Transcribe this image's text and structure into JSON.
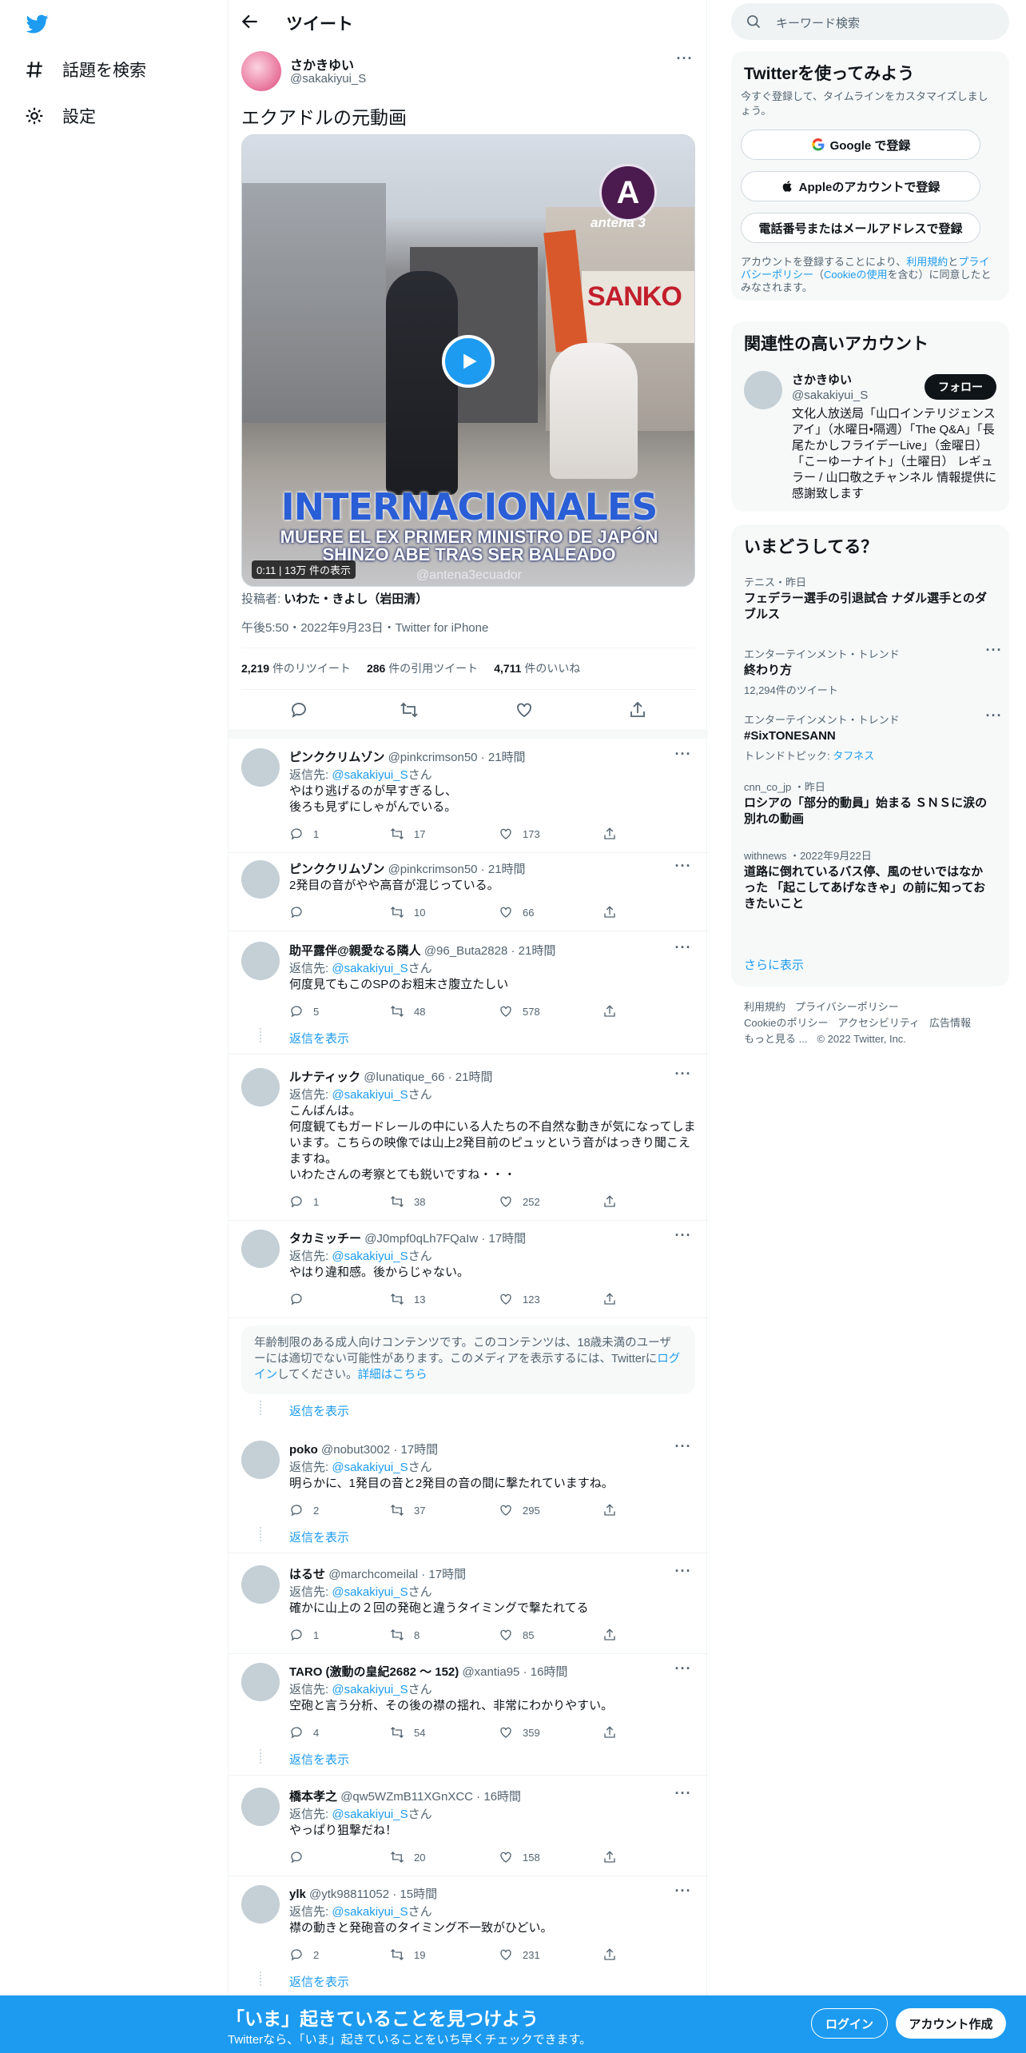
{
  "nav": {
    "explore": "話題を検索",
    "settings": "設定"
  },
  "header": {
    "title": "ツイート"
  },
  "tweet": {
    "name": "さかきゆい",
    "handle": "@sakakiyui_S",
    "text": "エクアドルの元動画",
    "video": {
      "logo_letter": "A",
      "logo_text": "antena 3",
      "sign_text": "SANKO",
      "headline": "INTERNACIONALES",
      "sub1": "MUERE EL EX PRIMER MINISTRO DE JAPÓN",
      "sub2": "SHINZO ABE TRAS SER BALEADO",
      "credit": "@antena3ecuador",
      "duration": "0:11",
      "views": "13万 件の表示"
    },
    "poster_label": "投稿者:",
    "poster_name": "いわた・きよし（岩田清）",
    "timestamp": "午後5:50・2022年9月23日・Twitter for iPhone",
    "stats": {
      "retweets_num": "2,219",
      "retweets_label": "件のリツイート",
      "quotes_num": "286",
      "quotes_label": "件の引用ツイート",
      "likes_num": "4,711",
      "likes_label": "件のいいね"
    }
  },
  "reply_to_label": "返信先:",
  "reply_to_handle": "@sakakiyui_S",
  "reply_to_suffix": "さん",
  "show_replies": "返信を表示",
  "replies": [
    {
      "name": "ピンククリムゾン",
      "handle": "@pinkcrimson50",
      "time": "21時間",
      "to": true,
      "text": "やはり逃げるのが早すぎるし、\n後ろも見ずにしゃがんでいる。",
      "replies": "1",
      "retweets": "17",
      "likes": "173"
    },
    {
      "name": "ピンククリムゾン",
      "handle": "@pinkcrimson50",
      "time": "21時間",
      "to": false,
      "text": "2発目の音がやや高音が混じっている。",
      "replies": "",
      "retweets": "10",
      "likes": "66"
    },
    {
      "name": "助平露伴@親愛なる隣人",
      "handle": "@96_Buta2828",
      "time": "21時間",
      "to": true,
      "text": "何度見てもこのSPのお粗末さ腹立たしい",
      "replies": "5",
      "retweets": "48",
      "likes": "578"
    },
    {
      "name": "ルナティック",
      "handle": "@lunatique_66",
      "time": "21時間",
      "to": true,
      "text": "こんばんは。\n何度観てもガードレールの中にいる人たちの不自然な動きが気になってしまいます。こちらの映像では山上2発目前のピュッという音がはっきり聞こえますね。\nいわたさんの考察とても鋭いですね・・・",
      "replies": "1",
      "retweets": "38",
      "likes": "252"
    },
    {
      "name": "タカミッチー",
      "handle": "@J0mpf0qLh7FQaIw",
      "time": "17時間",
      "to": true,
      "text": "やはり違和感。後からじゃない。",
      "replies": "",
      "retweets": "13",
      "likes": "123"
    },
    {
      "name": "poko",
      "handle": "@nobut3002",
      "time": "17時間",
      "to": true,
      "text": "明らかに、1発目の音と2発目の音の間に撃たれていますね。",
      "replies": "2",
      "retweets": "37",
      "likes": "295"
    },
    {
      "name": "はるせ",
      "handle": "@marchcomeilal",
      "time": "17時間",
      "to": true,
      "text": "確かに山上の２回の発砲と違うタイミングで撃たれてる",
      "replies": "1",
      "retweets": "8",
      "likes": "85"
    },
    {
      "name": "TARO (激動の皇紀2682 〜 152)",
      "handle": "@xantia95",
      "time": "16時間",
      "to": true,
      "text": "空砲と言う分析、その後の襟の揺れ、非常にわかりやすい。",
      "replies": "4",
      "retweets": "54",
      "likes": "359"
    },
    {
      "name": "橋本孝之",
      "handle": "@qw5WZmB11XGnXCC",
      "time": "16時間",
      "to": true,
      "text": "やっぱり狙撃だね！",
      "replies": "",
      "retweets": "20",
      "likes": "158"
    },
    {
      "name": "ylk",
      "handle": "@ytk98811052",
      "time": "15時間",
      "to": true,
      "text": "襟の動きと発砲音のタイミング不一致がひどい。",
      "replies": "2",
      "retweets": "19",
      "likes": "231"
    }
  ],
  "age_notice": {
    "text": "年齢制限のある成人向けコンテンツです。このコンテンツは、18歳未満のユーザーには適切でない可能性があります。このメディアを表示するには、Twitterに",
    "login": "ログイン",
    "mid": "してください。",
    "details": "詳細はこちら"
  },
  "right": {
    "search_placeholder": "キーワード検索",
    "signup_card": {
      "title": "Twitterを使ってみよう",
      "desc": "今すぐ登録して、タイムラインをカスタマイズしましょう。",
      "google": "Google で登録",
      "apple": "Appleのアカウントで登録",
      "phone": "電話番号またはメールアドレスで登録",
      "legal_1": "アカウントを登録することにより、",
      "legal_terms": "利用規約",
      "legal_2": "と",
      "legal_privacy": "プライバシーポリシー",
      "legal_3": "（",
      "legal_cookie": "Cookieの使用",
      "legal_4": "を含む）に同意したとみなされます。"
    },
    "related": {
      "title": "関連性の高いアカウント",
      "name": "さかきゆい",
      "handle": "@sakakiyui_S",
      "follow": "フォロー",
      "bio": "文化人放送局「山口インテリジェンスアイ」（水曜日•隔週）「The Q&A」「長尾たかしフライデーLive」（金曜日）「こーゆーナイト」（土曜日） レギュラー / 山口敬之チャンネル 情報提供に感謝致します"
    },
    "trends": {
      "title": "いまどうしてる？",
      "items": [
        {
          "cat": "テニス・昨日",
          "title": "フェデラー選手の引退試合 ナダル選手とのダブルス",
          "sub": ""
        },
        {
          "cat": "エンターテインメント・トレンド",
          "title": "終わり方",
          "sub": "12,294件のツイート"
        },
        {
          "cat": "エンターテインメント・トレンド",
          "title": "#SixTONESANN",
          "sub": "トレンドトピック: ",
          "sub_link": "タフネス"
        },
        {
          "cat": "cnn_co_jp ・昨日",
          "title": "ロシアの「部分的動員」始まる ＳＮＳに涙の別れの動画",
          "sub": ""
        },
        {
          "cat": "withnews ・2022年9月22日",
          "title": "道路に倒れているバス停、風のせいではなかった 「起こしてあげなきゃ」の前に知っておきたいこと",
          "sub": ""
        }
      ],
      "show_more": "さらに表示"
    },
    "footer": [
      "利用規約",
      "プライバシーポリシー",
      "Cookieのポリシー",
      "アクセシビリティ",
      "広告情報",
      "もっと見る ...",
      "© 2022 Twitter, Inc."
    ]
  },
  "bottombar": {
    "title": "「いま」起きていることを見つけよう",
    "subtitle": "Twitterなら、「いま」起きていることをいち早くチェックできます。",
    "login": "ログイン",
    "signup": "アカウント作成"
  },
  "colors": {
    "accent": "#1d9bf0",
    "text": "#0f1419",
    "muted": "#536471"
  }
}
